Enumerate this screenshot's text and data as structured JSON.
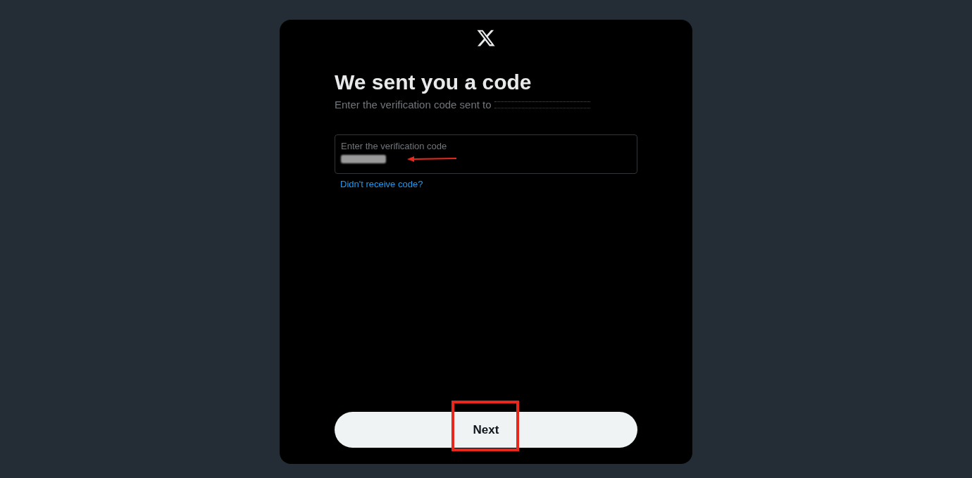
{
  "dialog": {
    "title": "We sent you a code",
    "subtitle": "Enter the verification code sent to",
    "email_redacted": true,
    "code_field": {
      "label": "Enter the verification code",
      "value_redacted": true
    },
    "resend_link": "Didn't receive code?",
    "next_button": "Next",
    "annotations": {
      "arrow_to_field": true,
      "box_around_button": true
    }
  }
}
